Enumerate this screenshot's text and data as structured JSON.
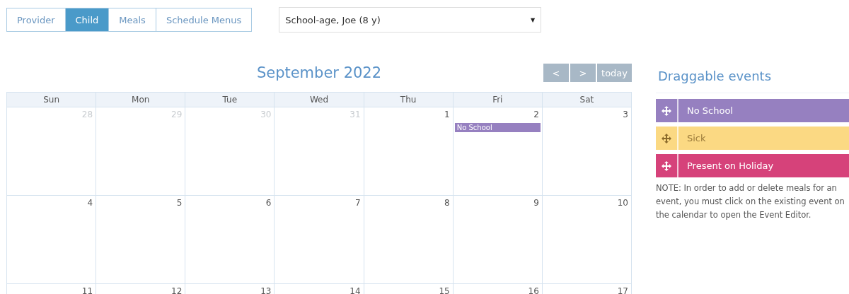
{
  "tabs": [
    {
      "label": "Provider",
      "selected": false
    },
    {
      "label": "Child",
      "selected": true
    },
    {
      "label": "Meals",
      "selected": false
    },
    {
      "label": "Schedule Menus",
      "selected": false
    }
  ],
  "child_select": {
    "value": "School-age, Joe (8 y)",
    "arrow": "▼"
  },
  "calendar": {
    "title": "September 2022",
    "nav": [
      {
        "label": "<"
      },
      {
        "label": ">"
      },
      {
        "label": "today"
      }
    ],
    "weekdays": [
      "Sun",
      "Mon",
      "Tue",
      "Wed",
      "Thu",
      "Fri",
      "Sat"
    ],
    "weeks": [
      [
        {
          "day": "28",
          "other_month": true
        },
        {
          "day": "29",
          "other_month": true
        },
        {
          "day": "30",
          "other_month": true
        },
        {
          "day": "31",
          "other_month": true
        },
        {
          "day": "1",
          "other_month": false
        },
        {
          "day": "2",
          "other_month": false,
          "events": [
            {
              "title": "No School",
              "color": "#9680c0"
            }
          ]
        },
        {
          "day": "3",
          "other_month": false
        }
      ],
      [
        {
          "day": "4",
          "other_month": false
        },
        {
          "day": "5",
          "other_month": false
        },
        {
          "day": "6",
          "other_month": false
        },
        {
          "day": "7",
          "other_month": false
        },
        {
          "day": "8",
          "other_month": false
        },
        {
          "day": "9",
          "other_month": false
        },
        {
          "day": "10",
          "other_month": false
        }
      ],
      [
        {
          "day": "11",
          "other_month": false
        },
        {
          "day": "12",
          "other_month": false
        },
        {
          "day": "13",
          "other_month": false
        },
        {
          "day": "14",
          "other_month": false
        },
        {
          "day": "15",
          "other_month": false
        },
        {
          "day": "16",
          "other_month": false
        },
        {
          "day": "17",
          "other_month": false
        }
      ]
    ]
  },
  "draggable": {
    "title": "Draggable events",
    "events": [
      {
        "title": "No School",
        "color": "#9680c0",
        "dark_text": false
      },
      {
        "title": "Sick",
        "color": "#fbd983",
        "dark_text": true
      },
      {
        "title": "Present on Holiday",
        "color": "#d6427a",
        "dark_text": false
      }
    ],
    "note": "NOTE: In order to add or delete meals for an event, you must click on the existing event on the calendar to open the Event Editor."
  }
}
